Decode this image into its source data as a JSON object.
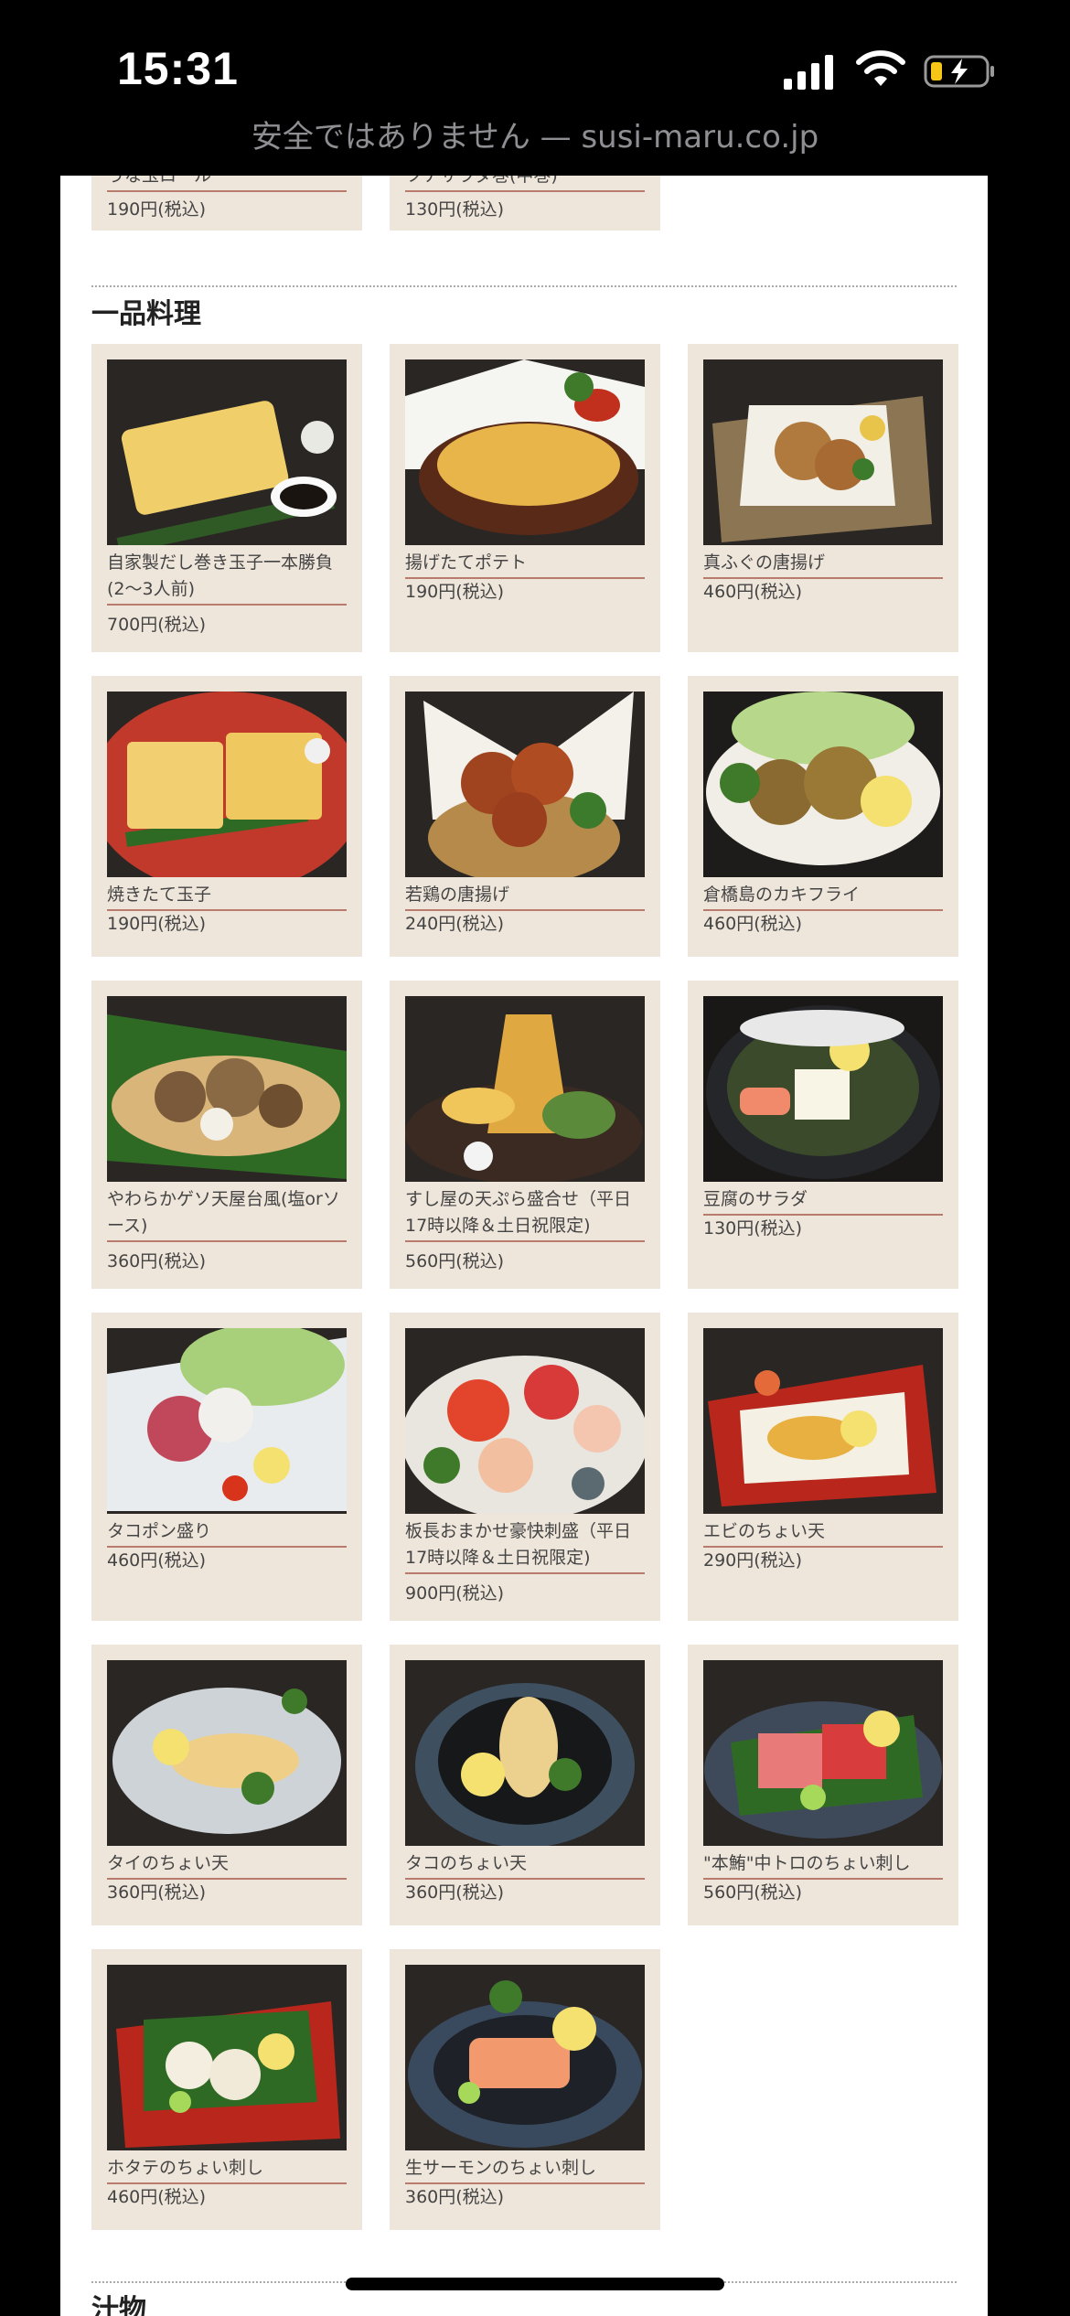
{
  "status_bar": {
    "time": "15:31"
  },
  "browser": {
    "url_text": "安全ではありません — susi-maru.co.jp"
  },
  "top_items": [
    {
      "name": "うな玉ロール",
      "price": "190円(税込)"
    },
    {
      "name": "ツナサラダ巻(中巻)",
      "price": "130円(税込)"
    }
  ],
  "section": {
    "title": "一品料理",
    "items": [
      {
        "name": "自家製だし巻き玉子一本勝負(2〜3人前)",
        "price": "700円(税込)"
      },
      {
        "name": "揚げたてポテト",
        "price": "190円(税込)"
      },
      {
        "name": "真ふぐの唐揚げ",
        "price": "460円(税込)"
      },
      {
        "name": "焼きたて玉子",
        "price": "190円(税込)"
      },
      {
        "name": "若鶏の唐揚げ",
        "price": "240円(税込)"
      },
      {
        "name": "倉橋島のカキフライ",
        "price": "460円(税込)"
      },
      {
        "name": "やわらかゲソ天屋台風(塩orソース)",
        "price": "360円(税込)"
      },
      {
        "name": "すし屋の天ぷら盛合せ（平日17時以降＆土日祝限定)",
        "price": "560円(税込)"
      },
      {
        "name": "豆腐のサラダ",
        "price": "130円(税込)"
      },
      {
        "name": "タコポン盛り",
        "price": "460円(税込)"
      },
      {
        "name": "板長おまかせ豪快刺盛（平日17時以降＆土日祝限定)",
        "price": "900円(税込)"
      },
      {
        "name": "エビのちょい天",
        "price": "290円(税込)"
      },
      {
        "name": "タイのちょい天",
        "price": "360円(税込)"
      },
      {
        "name": "タコのちょい天",
        "price": "360円(税込)"
      },
      {
        "name": "\"本鮪\"中トロのちょい刺し",
        "price": "560円(税込)"
      },
      {
        "name": "ホタテのちょい刺し",
        "price": "460円(税込)"
      },
      {
        "name": "生サーモンのちょい刺し",
        "price": "360円(税込)"
      }
    ]
  },
  "next_section": {
    "title": "汁物"
  }
}
